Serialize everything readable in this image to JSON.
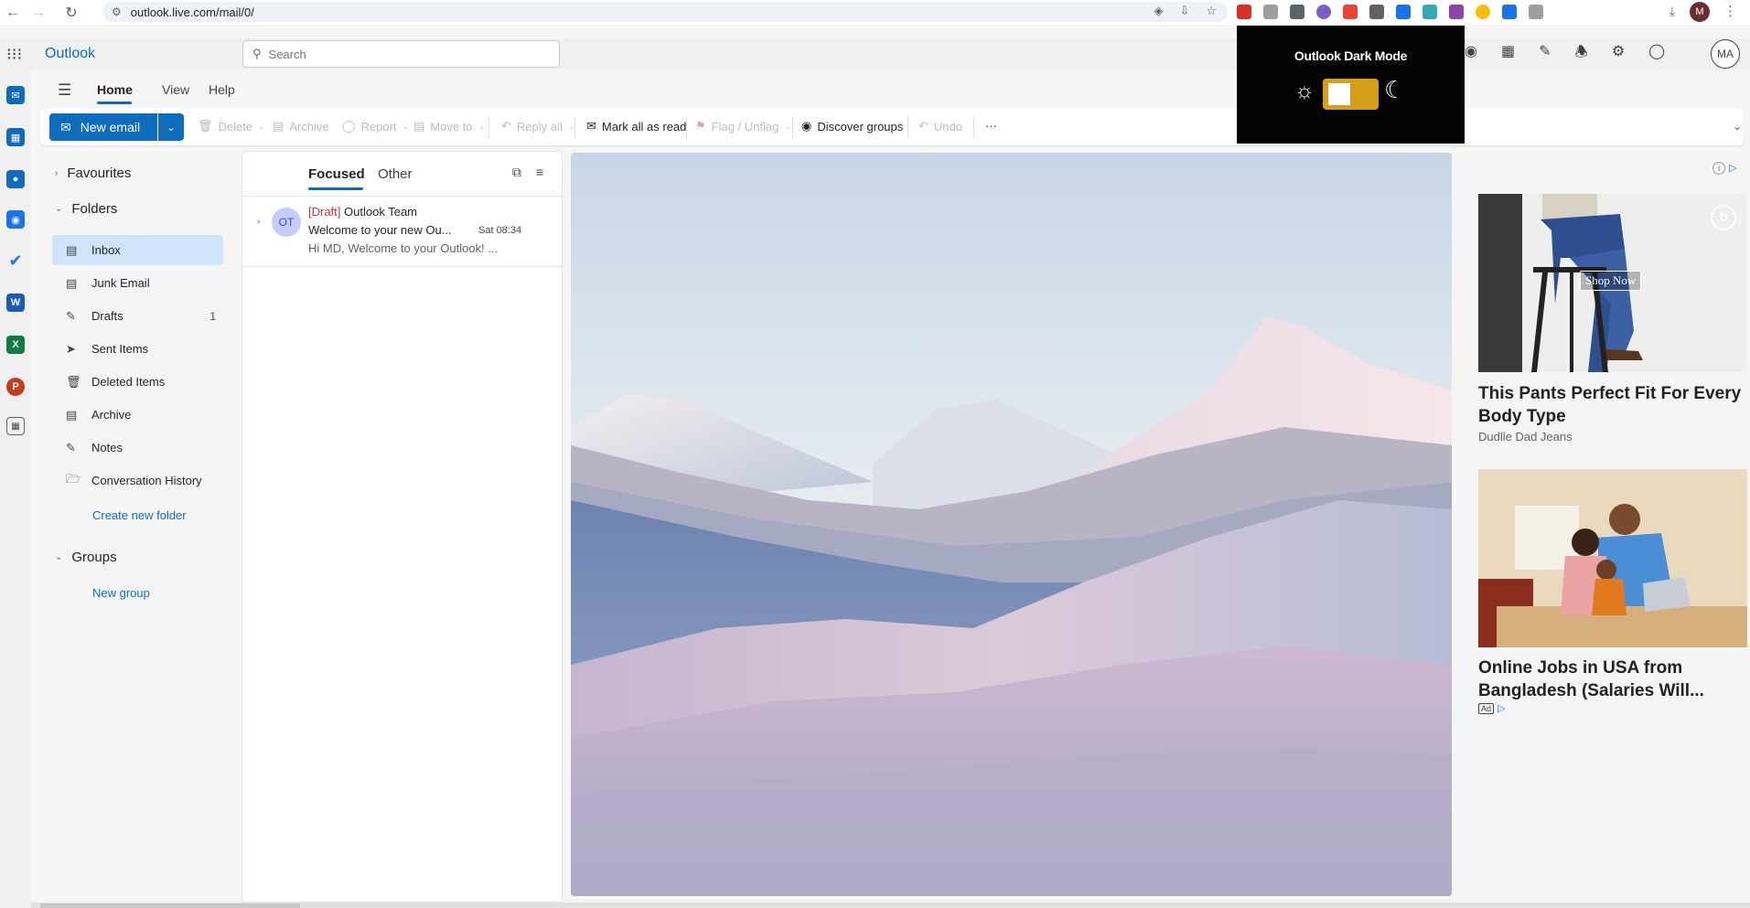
{
  "browser": {
    "url": "outlook.live.com/mail/0/",
    "profile_initial": "M"
  },
  "app": {
    "brand": "Outlook",
    "search_placeholder": "Search",
    "avatar_initials": "MA"
  },
  "tabs": [
    {
      "label": "Home"
    },
    {
      "label": "View"
    },
    {
      "label": "Help"
    }
  ],
  "ribbon": {
    "new_email": "New email",
    "delete": "Delete",
    "archive": "Archive",
    "report": "Report",
    "move_to": "Move to",
    "reply_all": "Reply all",
    "mark_all_read": "Mark all as read",
    "flag_unflag": "Flag / Unflag",
    "discover_groups": "Discover groups",
    "undo": "Undo",
    "more": "···"
  },
  "folder_pane": {
    "favourites": "Favourites",
    "folders_heading": "Folders",
    "folders": [
      {
        "label": "Inbox",
        "icon": "inbox-icon",
        "count": ""
      },
      {
        "label": "Junk Email",
        "icon": "junk-icon",
        "count": ""
      },
      {
        "label": "Drafts",
        "icon": "drafts-icon",
        "count": "1"
      },
      {
        "label": "Sent Items",
        "icon": "send-icon",
        "count": ""
      },
      {
        "label": "Deleted Items",
        "icon": "trash-icon",
        "count": ""
      },
      {
        "label": "Archive",
        "icon": "archive-icon",
        "count": ""
      },
      {
        "label": "Notes",
        "icon": "notes-icon",
        "count": ""
      },
      {
        "label": "Conversation History",
        "icon": "folder-icon",
        "count": ""
      }
    ],
    "create_folder": "Create new folder",
    "groups_heading": "Groups",
    "new_group": "New group"
  },
  "message_list": {
    "focused": "Focused",
    "other": "Other",
    "messages": [
      {
        "avatar": "OT",
        "draft_tag": "[Draft]",
        "from": "Outlook Team",
        "subject": "Welcome to your new Ou...",
        "time": "Sat 08:34",
        "preview": "Hi MD, Welcome to your Outlook! ..."
      }
    ]
  },
  "dark_mode": {
    "title": "Outlook Dark Mode"
  },
  "ads": [
    {
      "button": "Shop Now",
      "title": "This Pants Perfect Fit For Every Body Type",
      "source": "Dudlle Dad Jeans"
    },
    {
      "title": "Online Jobs in USA from Bangladesh (Salaries Will...",
      "badge": "Ad"
    }
  ],
  "colors": {
    "accent": "#0f6cbd",
    "selected_folder": "#cfe4fa",
    "toggle_on": "#d4a017"
  }
}
